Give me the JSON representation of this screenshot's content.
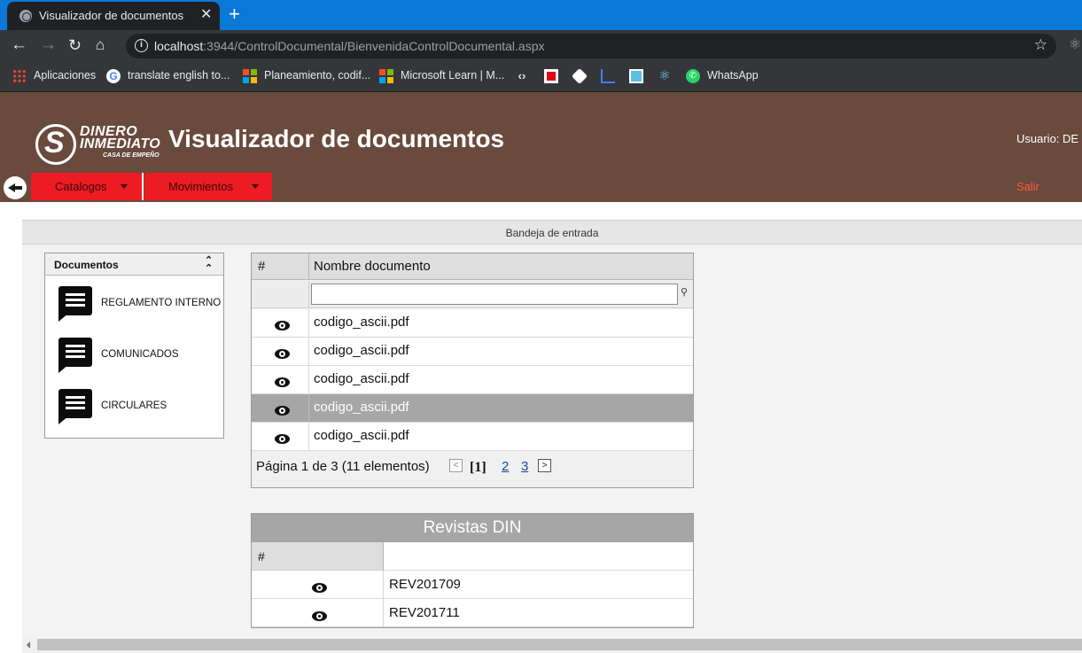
{
  "browser": {
    "tab_title": "Visualizador de documentos",
    "tab_close": "✕",
    "new_tab": "+",
    "url_host": "localhost",
    "url_rest": ":3944/ControlDocumental/BienvenidaControlDocumental.aspx",
    "bookmarks": [
      {
        "label": "Aplicaciones",
        "icon": "apps-grid-icon"
      },
      {
        "label": "translate english to...",
        "icon": "google-icon"
      },
      {
        "label": "Planeamiento, codif...",
        "icon": "microsoft-icon"
      },
      {
        "label": "Microsoft Learn | M...",
        "icon": "microsoft-icon"
      },
      {
        "label": "WhatsApp",
        "icon": "whatsapp-icon"
      }
    ]
  },
  "header": {
    "logo_line1": "DINERO",
    "logo_line2": "INMEDIATO",
    "logo_line3": "CASA DE EMPEÑO",
    "title": "Visualizador de documentos",
    "user_label": "Usuario: DE",
    "menu": [
      {
        "label": "Catalogos"
      },
      {
        "label": "Movimientos"
      }
    ],
    "logout": "Salir"
  },
  "main": {
    "inbox_title": "Bandeja de entrada",
    "documents_panel": {
      "title": "Documentos",
      "items": [
        {
          "label": "REGLAMENTO INTERNO"
        },
        {
          "label": "COMUNICADOS"
        },
        {
          "label": "CIRCULARES"
        }
      ]
    },
    "documents_grid": {
      "col_hash": "#",
      "col_name": "Nombre documento",
      "filter_value": "",
      "rows": [
        {
          "name": "codigo_ascii.pdf",
          "selected": false
        },
        {
          "name": "codigo_ascii.pdf",
          "selected": false
        },
        {
          "name": "codigo_ascii.pdf",
          "selected": false
        },
        {
          "name": "codigo_ascii.pdf",
          "selected": true
        },
        {
          "name": "codigo_ascii.pdf",
          "selected": false
        }
      ],
      "pager": {
        "summary": "Página 1 de 3 (11 elementos)",
        "current": "[1]",
        "pages": [
          "2",
          "3"
        ]
      }
    },
    "magazines_grid": {
      "title": "Revistas DIN",
      "col_hash": "#",
      "rows": [
        {
          "name": "REV201709"
        },
        {
          "name": "REV201711"
        }
      ]
    }
  }
}
